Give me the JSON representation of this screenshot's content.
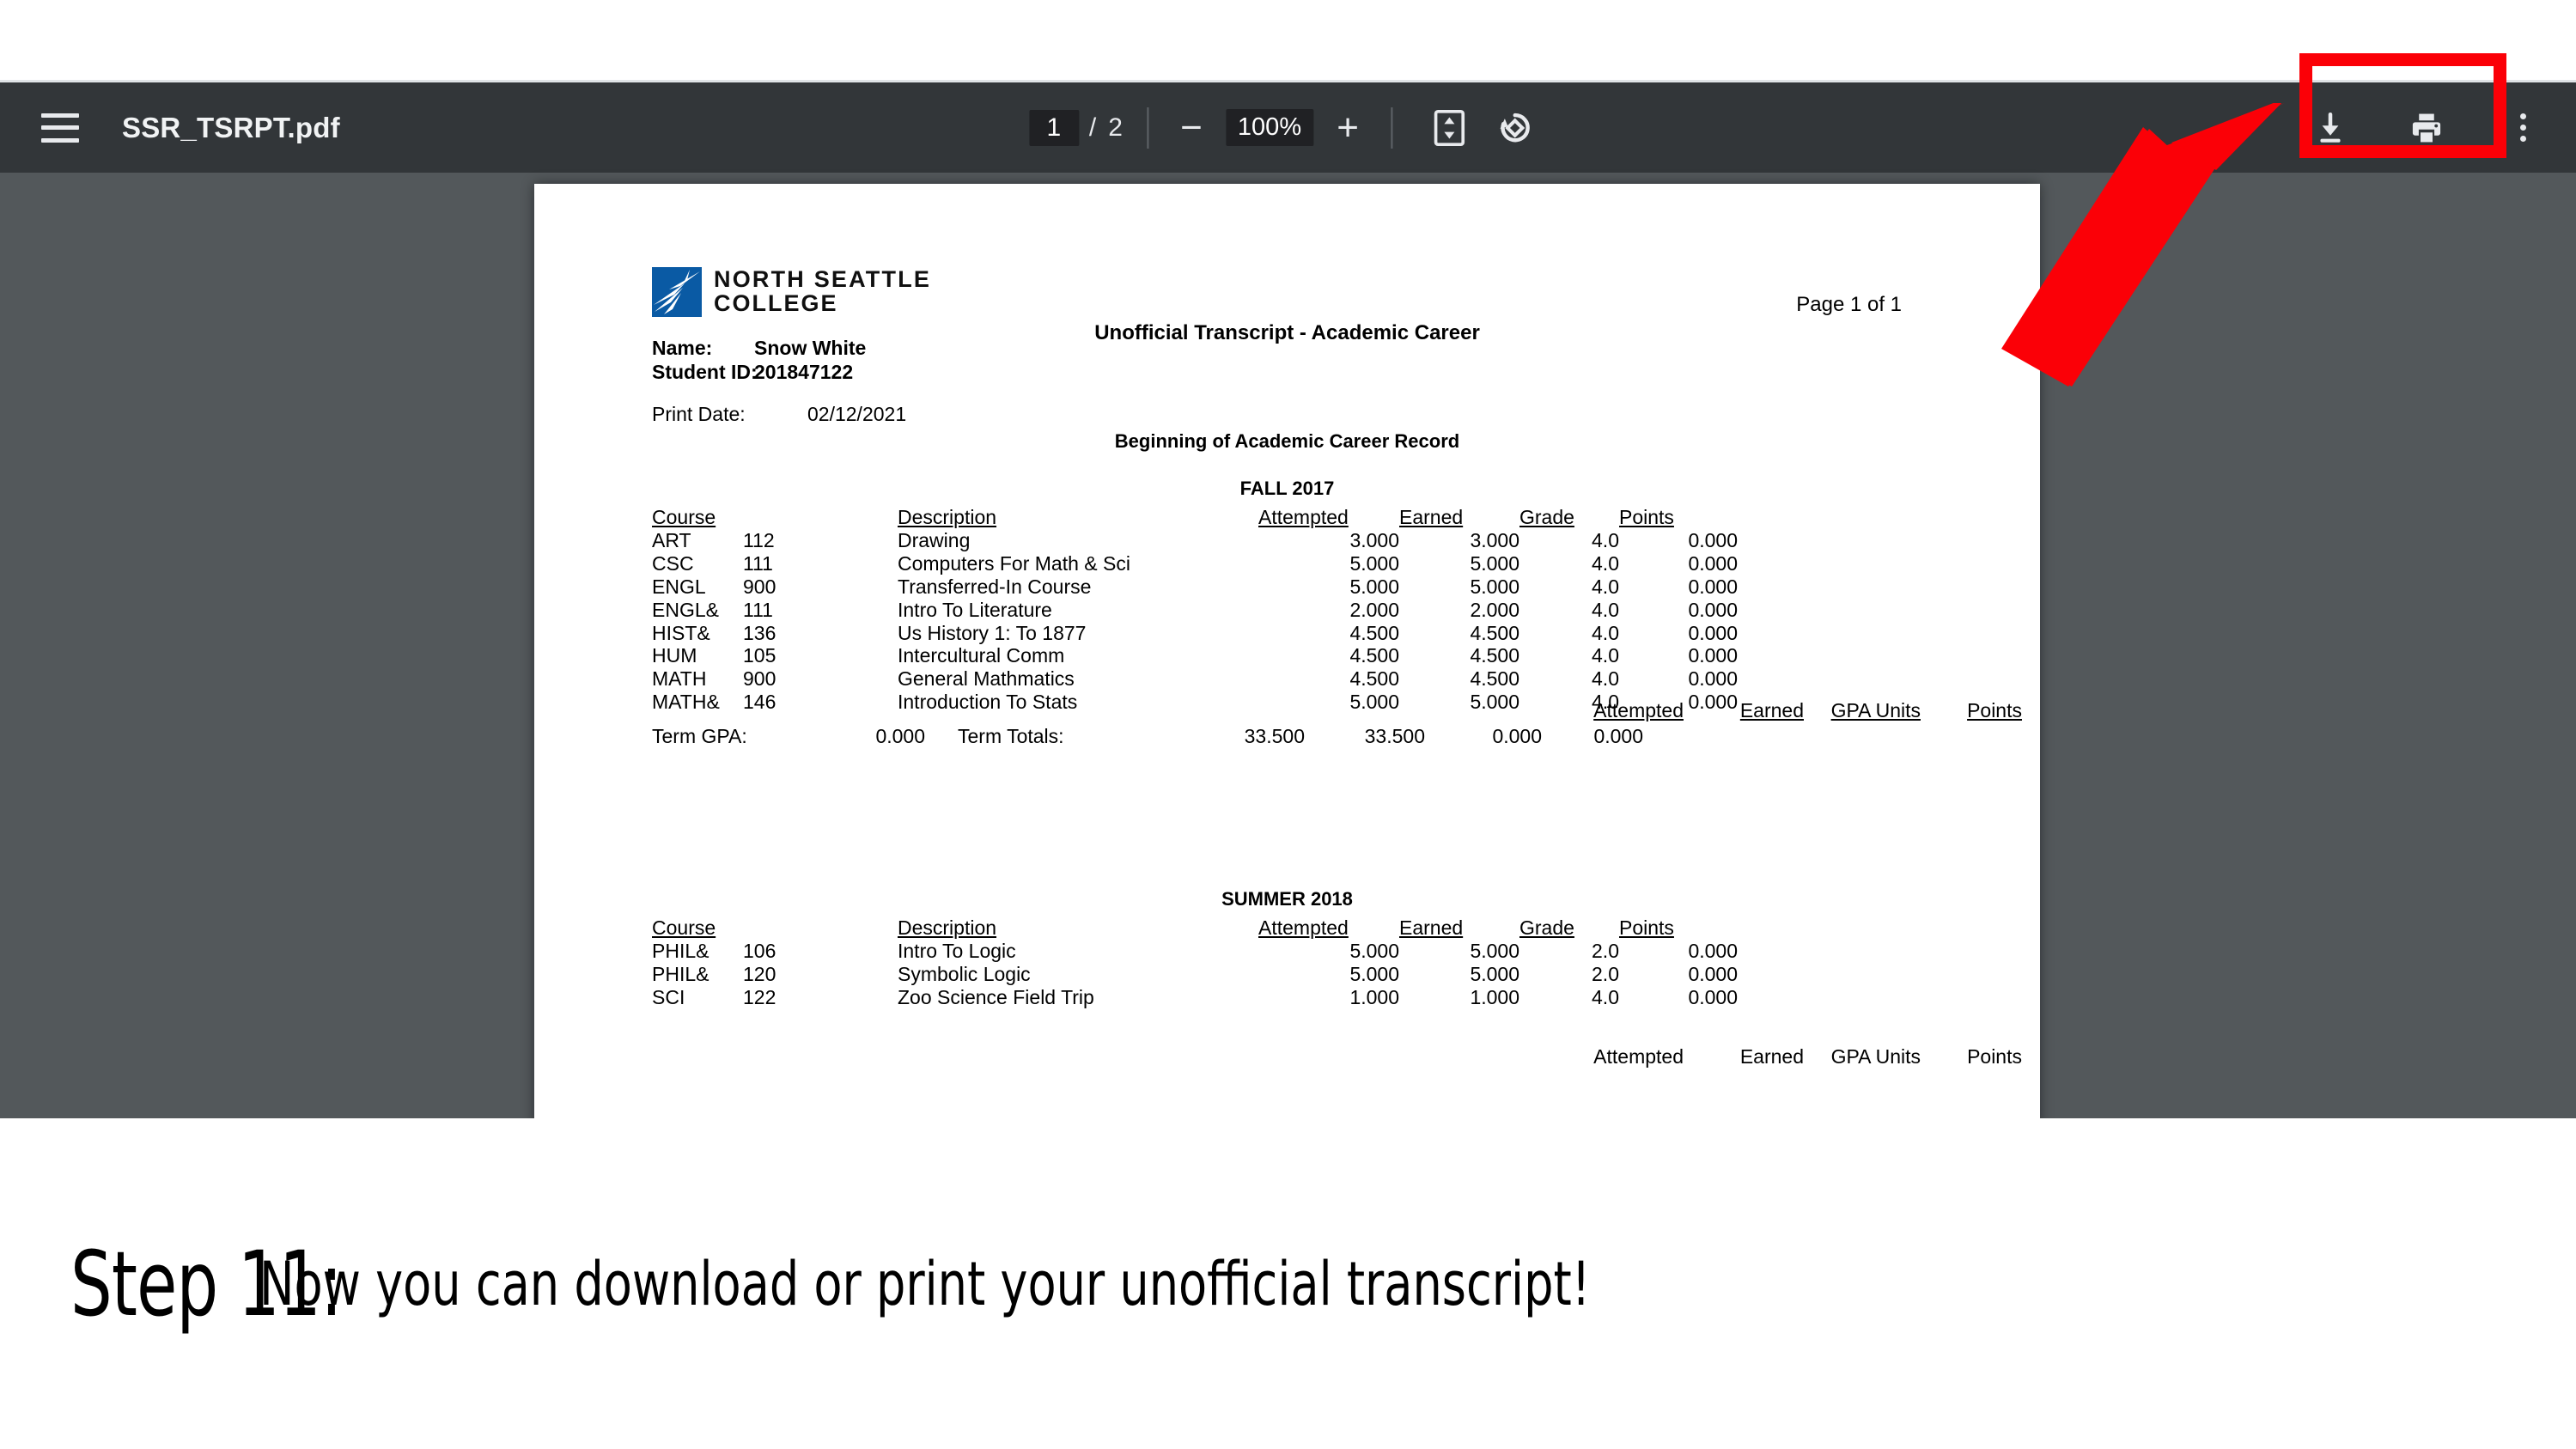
{
  "toolbar": {
    "menu_icon": "hamburger-icon",
    "file_name": "SSR_TSRPT.pdf",
    "current_page": "1",
    "page_separator": "/",
    "total_pages": "2",
    "zoom_out_label": "−",
    "zoom_level": "100%",
    "zoom_in_label": "+",
    "fit_page_icon": "fit-to-page-icon",
    "rotate_icon": "rotate-clockwise-icon",
    "download_icon": "download-icon",
    "print_icon": "print-icon",
    "more_icon": "more-vertical-icon",
    "background_color": "#323639",
    "viewer_background_color": "#53585b"
  },
  "document": {
    "logo": {
      "line1": "NORTH SEATTLE",
      "line2": "COLLEGE",
      "mark_color": "#0a5aa4"
    },
    "page_indicator": "Page 1 of 1",
    "title": "Unofficial Transcript - Academic Career",
    "name_label": "Name:",
    "name_value": "Snow White",
    "student_id_label": "Student ID:",
    "student_id_value": "201847122",
    "print_date_label": "Print Date:",
    "print_date_value": "02/12/2021",
    "career_record_heading": "Beginning of Academic Career Record",
    "column_headers": {
      "course": "Course",
      "description": "Description",
      "attempted": "Attempted",
      "earned": "Earned",
      "grade": "Grade",
      "points": "Points"
    },
    "totals_headers": {
      "attempted": "Attempted",
      "earned": "Earned",
      "gpa_units": "GPA Units",
      "points": "Points"
    },
    "terms": [
      {
        "name": "FALL 2017",
        "courses": [
          {
            "subject": "ART",
            "number": "112",
            "description": "Drawing",
            "attempted": "3.000",
            "earned": "3.000",
            "grade": "4.0",
            "points": "0.000"
          },
          {
            "subject": "CSC",
            "number": "111",
            "description": "Computers For Math & Sci",
            "attempted": "5.000",
            "earned": "5.000",
            "grade": "4.0",
            "points": "0.000"
          },
          {
            "subject": "ENGL",
            "number": "900",
            "description": "Transferred-In Course",
            "attempted": "5.000",
            "earned": "5.000",
            "grade": "4.0",
            "points": "0.000"
          },
          {
            "subject": "ENGL&",
            "number": "111",
            "description": "Intro To Literature",
            "attempted": "2.000",
            "earned": "2.000",
            "grade": "4.0",
            "points": "0.000"
          },
          {
            "subject": "HIST&",
            "number": "136",
            "description": "Us History 1: To 1877",
            "attempted": "4.500",
            "earned": "4.500",
            "grade": "4.0",
            "points": "0.000"
          },
          {
            "subject": "HUM",
            "number": "105",
            "description": "Intercultural Comm",
            "attempted": "4.500",
            "earned": "4.500",
            "grade": "4.0",
            "points": "0.000"
          },
          {
            "subject": "MATH",
            "number": "900",
            "description": "General Mathmatics",
            "attempted": "4.500",
            "earned": "4.500",
            "grade": "4.0",
            "points": "0.000"
          },
          {
            "subject": "MATH&",
            "number": "146",
            "description": "Introduction To Stats",
            "attempted": "5.000",
            "earned": "5.000",
            "grade": "4.0",
            "points": "0.000"
          }
        ],
        "term_gpa_label": "Term GPA:",
        "term_gpa_value": "0.000",
        "term_totals_label": "Term Totals:",
        "totals": {
          "attempted": "33.500",
          "earned": "33.500",
          "gpa_units": "0.000",
          "points": "0.000"
        }
      },
      {
        "name": "SUMMER 2018",
        "courses": [
          {
            "subject": "PHIL&",
            "number": "106",
            "description": "Intro To Logic",
            "attempted": "5.000",
            "earned": "5.000",
            "grade": "2.0",
            "points": "0.000"
          },
          {
            "subject": "PHIL&",
            "number": "120",
            "description": "Symbolic Logic",
            "attempted": "5.000",
            "earned": "5.000",
            "grade": "2.0",
            "points": "0.000"
          },
          {
            "subject": "SCI",
            "number": "122",
            "description": "Zoo Science Field Trip",
            "attempted": "1.000",
            "earned": "1.000",
            "grade": "4.0",
            "points": "0.000"
          }
        ]
      }
    ]
  },
  "annotations": {
    "highlight_color": "#fb0007",
    "arrow_color": "#fb0007"
  },
  "caption": {
    "step": "Step 11:",
    "text": "Now you can download or print your unofficial transcript!"
  }
}
